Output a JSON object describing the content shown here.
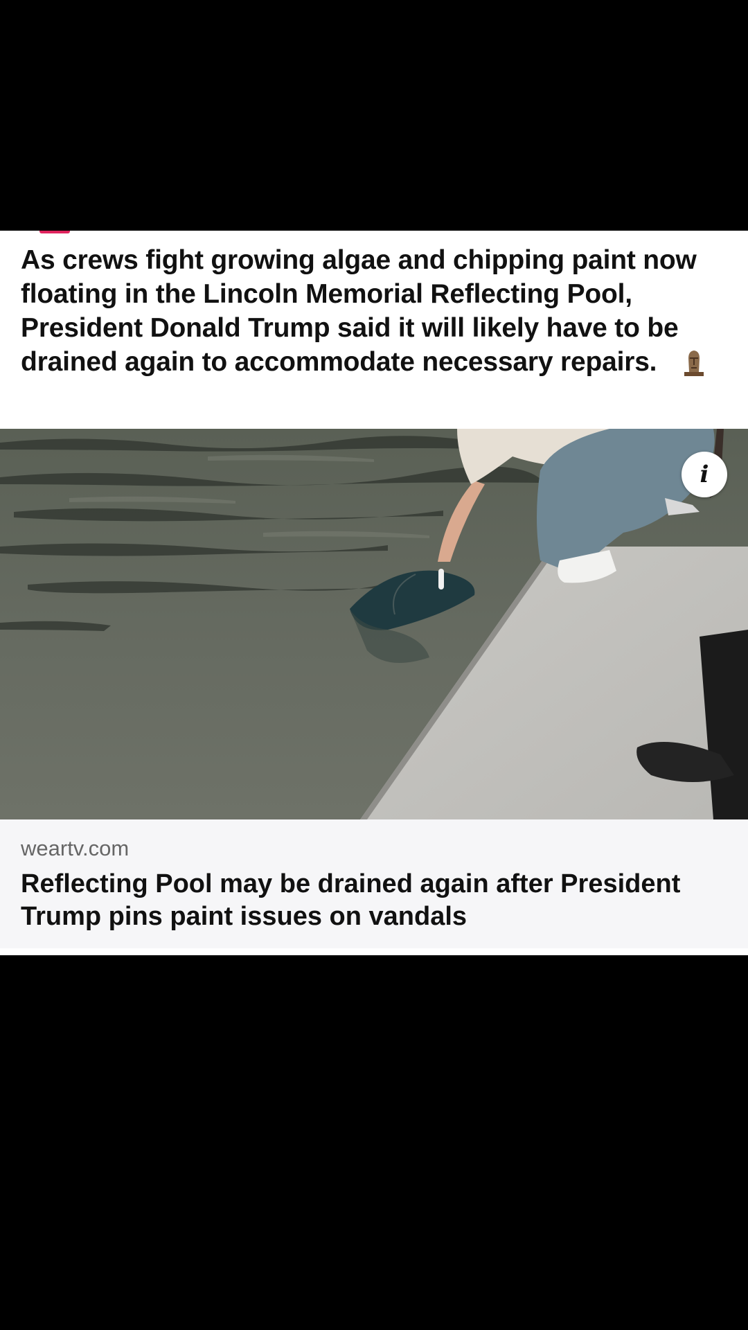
{
  "post": {
    "caption": "As crews fight growing algae and chipping paint now floating in the Lincoln Memorial Reflecting Pool, President Donald Trump said it will likely have to be drained again to accommodate necessary repairs.",
    "caption_emoji": "moai-icon"
  },
  "media": {
    "info_button_label": "i",
    "info_icon": "info-icon"
  },
  "link_preview": {
    "domain": "weartv.com",
    "title": "Reflecting Pool may be drained again after President Trump pins paint issues on vandals"
  },
  "colors": {
    "background": "#000000",
    "card": "#ffffff",
    "link_preview_bg": "#f6f6f8",
    "accent": "#e0245e"
  }
}
